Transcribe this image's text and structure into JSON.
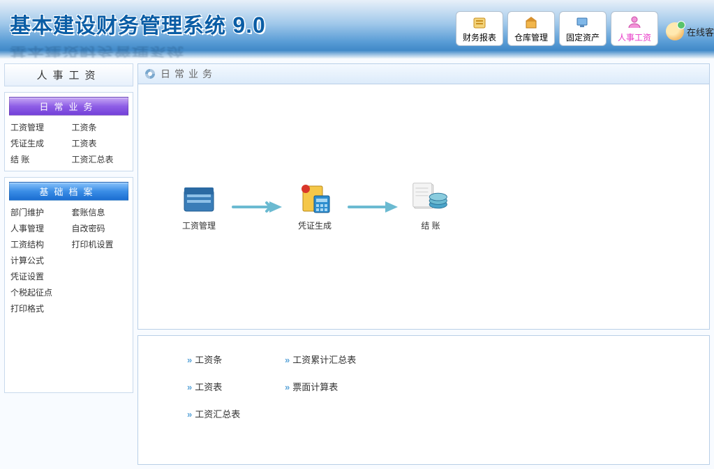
{
  "header": {
    "title": "基本建设财务管理系统",
    "version": "9.0",
    "buttons": [
      {
        "label": "财务报表",
        "icon": "report"
      },
      {
        "label": "仓库管理",
        "icon": "warehouse"
      },
      {
        "label": "固定资产",
        "icon": "asset"
      },
      {
        "label": "人事工资",
        "icon": "hr",
        "active": true
      }
    ],
    "online": "在线客"
  },
  "sidebar": {
    "title": "人事工资",
    "group1": {
      "header": "日常业务",
      "items": [
        "工资管理",
        "工资条",
        "凭证生成",
        "工资表",
        "结 账",
        "工资汇总表"
      ]
    },
    "group2": {
      "header": "基础档案",
      "items": [
        "部门维护",
        "套账信息",
        "人事管理",
        "自改密码",
        "工资结构",
        "打印机设置",
        "计算公式",
        "",
        "凭证设置",
        "",
        "个税起征点",
        "",
        "打印格式",
        ""
      ]
    }
  },
  "main": {
    "panel_title": "日常业务",
    "flow": [
      {
        "label": "工资管理",
        "icon": "salary"
      },
      {
        "label": "凭证生成",
        "icon": "voucher"
      },
      {
        "label": "结 账",
        "icon": "settle"
      }
    ],
    "links": [
      "工资条",
      "工资累计汇总表",
      "工资表",
      "票面计算表",
      "工资汇总表",
      ""
    ]
  }
}
